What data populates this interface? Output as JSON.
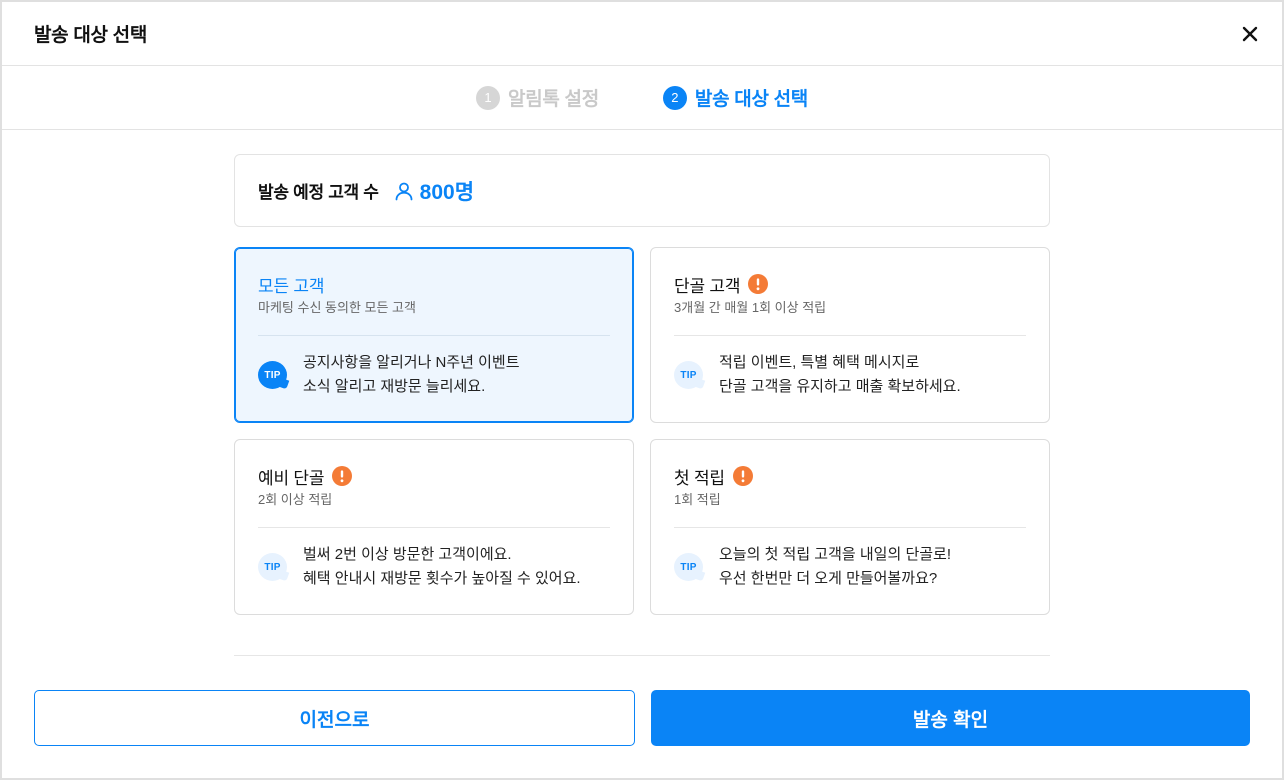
{
  "dialog": {
    "title": "발송 대상 선택",
    "close_icon": "close-icon"
  },
  "stepper": {
    "steps": [
      {
        "number": "1",
        "label": "알림톡 설정",
        "active": false
      },
      {
        "number": "2",
        "label": "발송 대상 선택",
        "active": true
      }
    ]
  },
  "summary": {
    "label": "발송 예정 고객 수",
    "icon": "person-icon",
    "count": "800명"
  },
  "audience_options": [
    {
      "title": "모든 고객",
      "subtitle": "마케팅 수신 동의한 모든 고객",
      "selected": true,
      "warning_icon": false,
      "tip_label": "TIP",
      "tip_lines": [
        "공지사항을 알리거나 N주년 이벤트",
        "소식 알리고 재방문 늘리세요."
      ]
    },
    {
      "title": "단골 고객",
      "subtitle": "3개월 간 매월 1회 이상 적립",
      "selected": false,
      "warning_icon": true,
      "tip_label": "TIP",
      "tip_lines": [
        "적립 이벤트, 특별 혜택 메시지로",
        "단골 고객을 유지하고 매출 확보하세요."
      ]
    },
    {
      "title": "예비 단골",
      "subtitle": "2회 이상 적립",
      "selected": false,
      "warning_icon": true,
      "tip_label": "TIP",
      "tip_lines": [
        "벌써 2번 이상 방문한 고객이에요.",
        "혜택 안내시 재방문 횟수가 높아질 수 있어요."
      ]
    },
    {
      "title": "첫 적립",
      "subtitle": "1회 적립",
      "selected": false,
      "warning_icon": true,
      "tip_label": "TIP",
      "tip_lines": [
        "오늘의 첫 적립 고객을 내일의 단골로!",
        "우선 한번만 더 오게 만들어볼까요?"
      ]
    }
  ],
  "icons": {
    "warning": "exclamation-circle-icon",
    "tip": "tip-bubble-icon"
  },
  "footer": {
    "prev_label": "이전으로",
    "confirm_label": "발송 확인"
  },
  "colors": {
    "primary": "#0a84f6",
    "warning": "#f47b36",
    "selected_background": "#eef6fe",
    "border": "#dcdcdc"
  }
}
